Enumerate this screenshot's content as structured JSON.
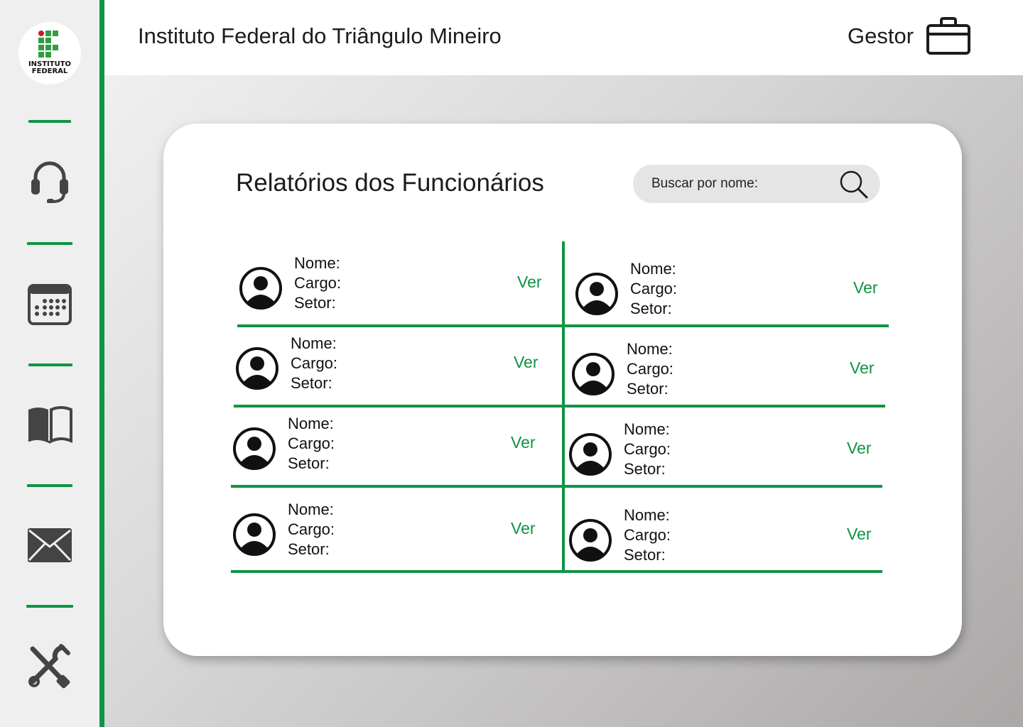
{
  "sidebar": {
    "logo": {
      "line1": "INSTITUTO",
      "line2": "FEDERAL",
      "colors": {
        "green": "#2f9e41",
        "red": "#cd191e"
      }
    },
    "items": [
      {
        "name": "support",
        "icon": "headset-icon"
      },
      {
        "name": "calendar",
        "icon": "calendar-icon"
      },
      {
        "name": "library",
        "icon": "book-icon"
      },
      {
        "name": "messages",
        "icon": "envelope-icon"
      },
      {
        "name": "settings",
        "icon": "tools-icon"
      }
    ]
  },
  "header": {
    "title": "Instituto Federal do Triângulo Mineiro",
    "role": "Gestor",
    "role_icon": "briefcase-icon"
  },
  "main": {
    "title": "Relatórios dos Funcionários",
    "search": {
      "placeholder": "Buscar por nome:",
      "value": ""
    },
    "employees": [
      {
        "nome_label": "Nome:",
        "cargo_label": "Cargo:",
        "setor_label": "Setor:",
        "action": "Ver"
      },
      {
        "nome_label": "Nome:",
        "cargo_label": "Cargo:",
        "setor_label": "Setor:",
        "action": "Ver"
      },
      {
        "nome_label": "Nome:",
        "cargo_label": "Cargo:",
        "setor_label": "Setor:",
        "action": "Ver"
      },
      {
        "nome_label": "Nome:",
        "cargo_label": "Cargo:",
        "setor_label": "Setor:",
        "action": "Ver"
      },
      {
        "nome_label": "Nome:",
        "cargo_label": "Cargo:",
        "setor_label": "Setor:",
        "action": "Ver"
      },
      {
        "nome_label": "Nome:",
        "cargo_label": "Cargo:",
        "setor_label": "Setor:",
        "action": "Ver"
      },
      {
        "nome_label": "Nome:",
        "cargo_label": "Cargo:",
        "setor_label": "Setor:",
        "action": "Ver"
      },
      {
        "nome_label": "Nome:",
        "cargo_label": "Cargo:",
        "setor_label": "Setor:",
        "action": "Ver"
      }
    ]
  },
  "colors": {
    "accent": "#0f9444",
    "sidebar_bg": "#efefef",
    "icon": "#444444"
  }
}
